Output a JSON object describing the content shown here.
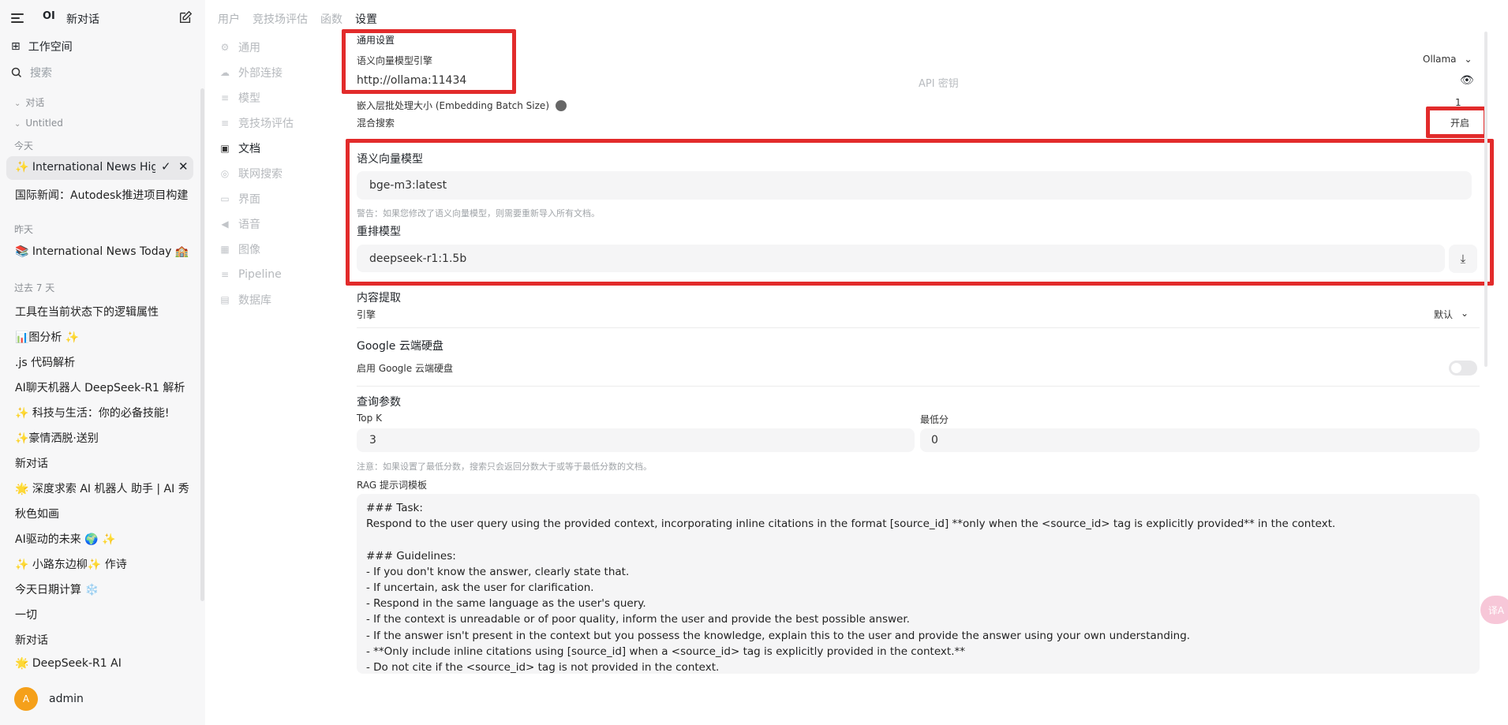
{
  "sidebar": {
    "logo": "OI",
    "new_chat": "新对话",
    "workspace": "工作空间",
    "search_placeholder": "搜索",
    "folders": {
      "chats": "对话",
      "untitled": "Untitled"
    },
    "today_label": "今天",
    "yesterday_label": "昨天",
    "past7_label": "过去 7 天",
    "today_items": [
      "✨ International News Highlights",
      "国际新闻：Autodesk推进项目构建"
    ],
    "yesterday_items": [
      "📚 International News Today 🏫"
    ],
    "past7_items": [
      "工具在当前状态下的逻辑属性",
      "📊图分析 ✨",
      ".js 代码解析",
      "AI聊天机器人 DeepSeek-R1 解析",
      "✨ 科技与生活：你的必备技能!",
      "✨豪情洒脱·送别",
      "新对话",
      "🌟 深度求索 AI 机器人 助手 | AI 秀",
      "秋色如画",
      "AI驱动的未来 🌍 ✨",
      "✨ 小路东边柳✨ 作诗",
      "今天日期计算 ❄️",
      "一切",
      "新对话",
      "🌟 DeepSeek-R1 AI"
    ],
    "user": {
      "initial": "A",
      "name": "admin"
    }
  },
  "top_tabs": [
    "用户",
    "竞技场评估",
    "函数",
    "设置"
  ],
  "settings_nav": [
    {
      "label": "通用",
      "icon": "gear-icon",
      "glyph": "⚙"
    },
    {
      "label": "外部连接",
      "icon": "cloud-icon",
      "glyph": "☁"
    },
    {
      "label": "模型",
      "icon": "layers-icon",
      "glyph": "≡"
    },
    {
      "label": "竞技场评估",
      "icon": "layers-icon",
      "glyph": "≡"
    },
    {
      "label": "文档",
      "icon": "document-icon",
      "glyph": "▣"
    },
    {
      "label": "联网搜索",
      "icon": "globe-icon",
      "glyph": "◎"
    },
    {
      "label": "界面",
      "icon": "monitor-icon",
      "glyph": "▭"
    },
    {
      "label": "语音",
      "icon": "speaker-icon",
      "glyph": "◀"
    },
    {
      "label": "图像",
      "icon": "image-icon",
      "glyph": "▦"
    },
    {
      "label": "Pipeline",
      "icon": "layers-icon",
      "glyph": "≡"
    },
    {
      "label": "数据库",
      "icon": "database-icon",
      "glyph": "▤"
    }
  ],
  "docs": {
    "general_heading": "通用设置",
    "embedding_engine_label": "语义向量模型引擎",
    "embedding_engine_value": "Ollama",
    "ollama_url": "http://ollama:11434",
    "api_key_placeholder": "API 密钥",
    "batch_size_label": "嵌入层批处理大小 (Embedding Batch Size)",
    "batch_size_value": "1",
    "hybrid_search_label": "混合搜索",
    "hybrid_search_value": "开启",
    "embedding_model_label": "语义向量模型",
    "embedding_model_value": "bge-m3:latest",
    "embedding_warning": "警告：如果您修改了语义向量模型，则需要重新导入所有文档。",
    "rerank_model_label": "重排模型",
    "rerank_model_value": "deepseek-r1:1.5b",
    "content_extraction_heading": "内容提取",
    "engine_label": "引擎",
    "engine_value": "默认",
    "gdrive_heading": "Google 云端硬盘",
    "gdrive_enable_label": "启用 Google 云端硬盘",
    "query_params_heading": "查询参数",
    "top_k_label": "Top K",
    "top_k_value": "3",
    "min_score_label": "最低分",
    "min_score_value": "0",
    "min_score_note": "注意：如果设置了最低分数，搜索只会返回分数大于或等于最低分数的文档。",
    "rag_template_label": "RAG 提示词模板",
    "rag_template_text": "### Task:\nRespond to the user query using the provided context, incorporating inline citations in the format [source_id] **only when the <source_id> tag is explicitly provided** in the context.\n\n### Guidelines:\n- If you don't know the answer, clearly state that.\n- If uncertain, ask the user for clarification.\n- Respond in the same language as the user's query.\n- If the context is unreadable or of poor quality, inform the user and provide the best possible answer.\n- If the answer isn't present in the context but you possess the knowledge, explain this to the user and provide the answer using your own understanding.\n- **Only include inline citations using [source_id] when a <source_id> tag is explicitly provided in the context.**\n- Do not cite if the <source_id> tag is not provided in the context."
  },
  "translate_fab": "译A",
  "colors": {
    "highlight": "#e22b2b",
    "avatar": "#f5a01a",
    "sidebar_bg": "#f7f7f8"
  }
}
